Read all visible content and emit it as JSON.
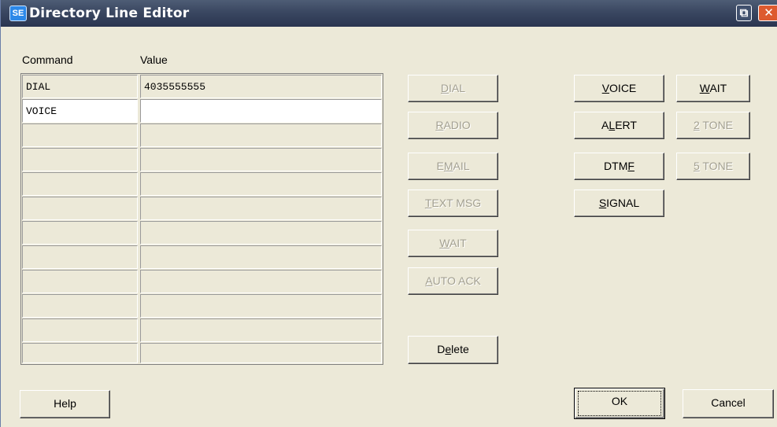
{
  "window": {
    "title": "Directory Line Editor",
    "app_icon_text": "SE"
  },
  "titlebar": {
    "restore_glyph": "⧉",
    "close_glyph": "✕"
  },
  "grid": {
    "headers": {
      "command": "Command",
      "value": "Value"
    },
    "rows": [
      {
        "command": "DIAL",
        "value": "4035555555"
      },
      {
        "command": "VOICE",
        "value": ""
      },
      {
        "command": "",
        "value": ""
      },
      {
        "command": "",
        "value": ""
      },
      {
        "command": "",
        "value": ""
      },
      {
        "command": "",
        "value": ""
      },
      {
        "command": "",
        "value": ""
      },
      {
        "command": "",
        "value": ""
      },
      {
        "command": "",
        "value": ""
      },
      {
        "command": "",
        "value": ""
      },
      {
        "command": "",
        "value": ""
      },
      {
        "command": "",
        "value": ""
      }
    ]
  },
  "action_buttons": [
    {
      "label": "DIAL",
      "mnemonic": "D",
      "enabled": false
    },
    {
      "label": "RADIO",
      "mnemonic": "R",
      "enabled": false
    },
    {
      "label": "EMAIL",
      "mnemonic": "M",
      "enabled": false
    },
    {
      "label": "TEXT MSG",
      "mnemonic": "T",
      "enabled": false
    },
    {
      "label": "WAIT",
      "mnemonic": "W",
      "enabled": false
    },
    {
      "label": "AUTO ACK",
      "mnemonic": "A",
      "enabled": false
    },
    {
      "label": "Delete",
      "mnemonic": "e",
      "enabled": true
    }
  ],
  "command_buttons": [
    {
      "label": "VOICE",
      "mnemonic": "V",
      "enabled": true
    },
    {
      "label": "WAIT",
      "mnemonic": "W",
      "enabled": true
    },
    {
      "label": "ALERT",
      "mnemonic": "L",
      "enabled": true
    },
    {
      "label": "2 TONE",
      "mnemonic": "2",
      "enabled": false
    },
    {
      "label": "DTMF",
      "mnemonic": "F",
      "enabled": true
    },
    {
      "label": "5 TONE",
      "mnemonic": "5",
      "enabled": false
    },
    {
      "label": "SIGNAL",
      "mnemonic": "S",
      "enabled": true
    }
  ],
  "footer": {
    "help_label": "Help",
    "ok_label": "OK",
    "cancel_label": "Cancel"
  }
}
